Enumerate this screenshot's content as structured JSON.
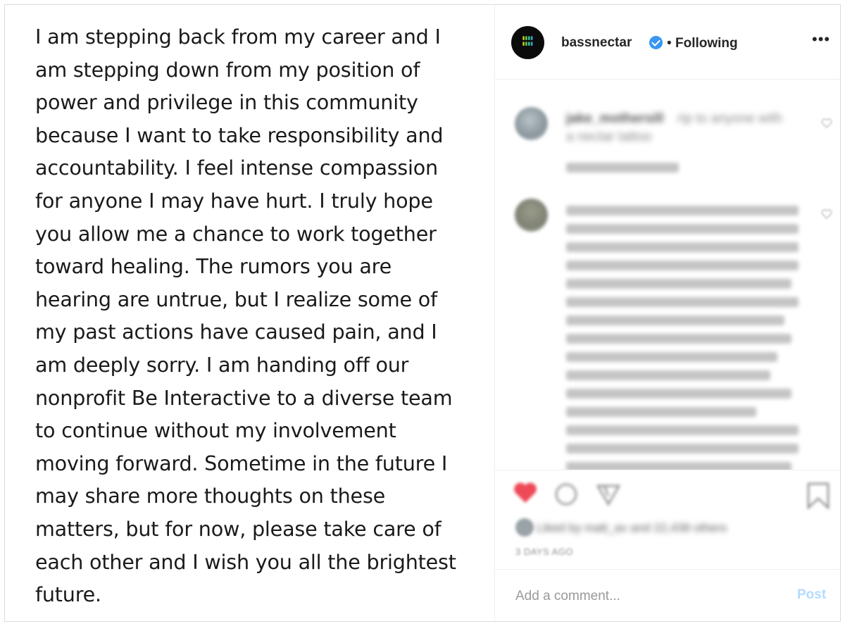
{
  "post": {
    "statement_lines": [
      "I am stepping back from my career and I",
      "am stepping down from my position of",
      "power and privilege in this community",
      "because I want to take responsibility and",
      "accountability. I feel intense compassion",
      "for anyone I may have hurt. I truly hope",
      "you allow me a chance to work together",
      "toward healing. The rumors you are",
      "hearing are untrue, but I realize some of",
      "my past actions have caused pain, and I",
      "am deeply sorry. I am handing off our",
      "nonprofit Be Interactive to a diverse team",
      "to continue without my involvement",
      "moving forward. Sometime in the future I",
      "may share more thoughts on these",
      "matters, but for now, please take care of",
      "each other and I wish you all the brightest",
      "future."
    ]
  },
  "header": {
    "username": "bassnectar",
    "separator": "•",
    "follow_status": "Following",
    "more_glyph": "•••",
    "icons": {
      "avatar": "profile-avatar",
      "verified": "verified-badge-icon",
      "more": "more-options-icon"
    },
    "colors": {
      "verified": "#3897f0"
    }
  },
  "comments": [
    {
      "username": "jake_mothersill",
      "text": "rip to anyone with a nectar tattoo"
    }
  ],
  "actions": {
    "icons": [
      "like-icon",
      "comment-icon",
      "share-icon",
      "save-icon"
    ],
    "like_color": "#ed4956",
    "timestamp": "3 DAYS AGO"
  },
  "add_comment": {
    "placeholder": "Add a comment...",
    "post_label": "Post",
    "post_color": "#b3dbff"
  }
}
